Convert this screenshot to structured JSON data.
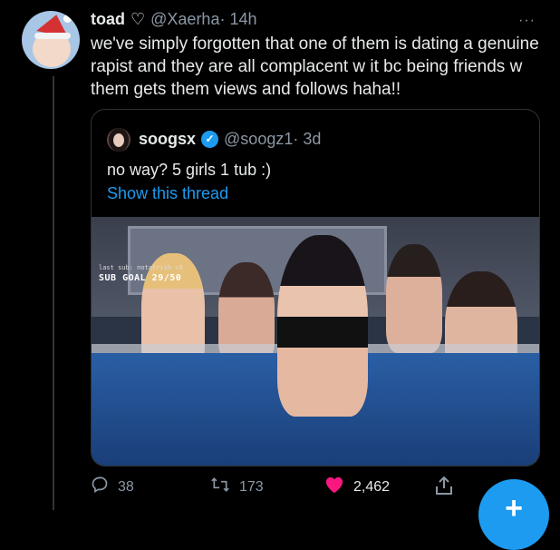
{
  "tweet": {
    "author_name": "toad",
    "handle": "@Xaerha",
    "time": "· 14h",
    "text": "we've simply forgotten that one of them is dating a genuine rapist and they are all complacent w it bc being friends w them gets them views and follows haha!!",
    "more_label": "···"
  },
  "quoted": {
    "author_name": "soogsx",
    "handle": "@soogz1",
    "time": "· 3d",
    "text": "no way? 5 girls 1 tub :)",
    "show_thread": "Show this thread",
    "media_overlay_line1": "last sub: notatrish <3",
    "media_overlay_line2": "SUB GOAL 29/50"
  },
  "actions": {
    "replies": "38",
    "retweets": "173",
    "likes": "2,462"
  },
  "colors": {
    "accent": "#1d9bf0",
    "like": "#f91880",
    "muted": "#8b98a5"
  },
  "icons": {
    "reply": "reply-icon",
    "retweet": "retweet-icon",
    "like": "heart-icon",
    "share": "share-icon"
  }
}
